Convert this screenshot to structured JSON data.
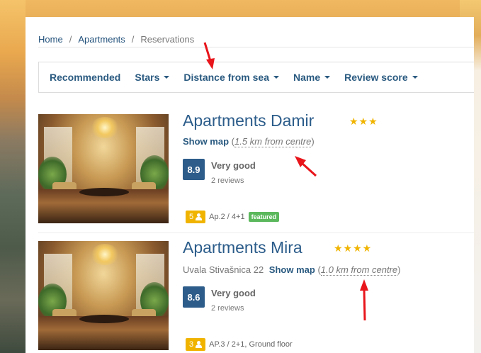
{
  "breadcrumb": {
    "items": [
      "Home",
      "Apartments"
    ],
    "separator": "/",
    "current": "Reservations"
  },
  "sort_bar": {
    "items": [
      {
        "label": "Recommended",
        "has_caret": false
      },
      {
        "label": "Stars",
        "has_caret": true
      },
      {
        "label": "Distance from sea",
        "has_caret": true
      },
      {
        "label": "Name",
        "has_caret": true
      },
      {
        "label": "Review score",
        "has_caret": true
      }
    ]
  },
  "listings": [
    {
      "name": "Apartments Damir",
      "stars": "★★★",
      "star_count": 3,
      "address": "",
      "show_map": "Show map",
      "distance_open": "(",
      "distance": "1.5 km from centre",
      "distance_close": ")",
      "score": "8.9",
      "rating_label": "Very good",
      "reviews": "2 reviews",
      "guests": "5",
      "unit": "Ap.2 / 4+1",
      "badge": "featured"
    },
    {
      "name": "Apartments Mira",
      "stars": "★★★★",
      "star_count": 4,
      "address": "Uvala Stivašnica 22",
      "show_map": "Show map",
      "distance_open": "(",
      "distance": "1.0 km from centre",
      "distance_close": ")",
      "score": "8.6",
      "rating_label": "Very good",
      "reviews": "2 reviews",
      "guests": "3",
      "unit": "AP.3 / 2+1, Ground floor",
      "badge": ""
    }
  ],
  "colors": {
    "link": "#2a5a80",
    "title": "#2b5c8a",
    "score_bg": "#2d5c8a",
    "stars": "#f0b400",
    "guests_bg": "#f0b400",
    "featured_bg": "#5cb85c",
    "annotation_arrows": "#e8151b"
  }
}
